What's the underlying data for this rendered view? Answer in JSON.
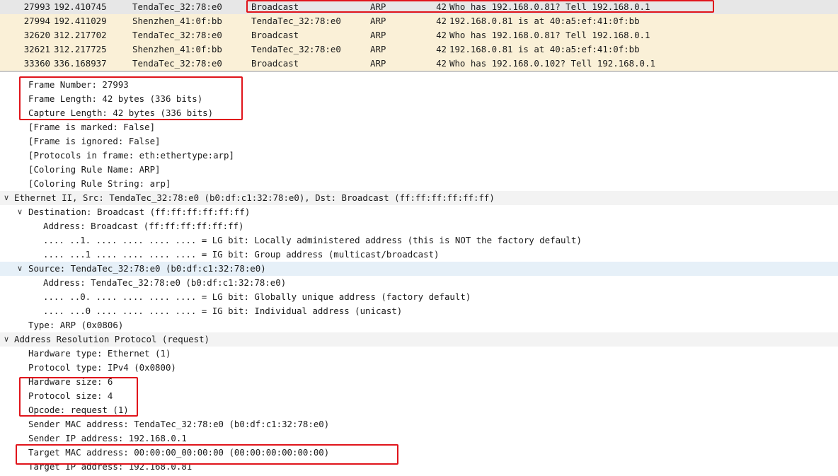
{
  "packet_list": [
    {
      "no": "27993",
      "time": "192.410745",
      "src": "TendaTec_32:78:e0",
      "dst": "Broadcast",
      "proto": "ARP",
      "len": "42",
      "info": "Who has 192.168.0.81? Tell 192.168.0.1",
      "selected": true
    },
    {
      "no": "27994",
      "time": "192.411029",
      "src": "Shenzhen_41:0f:bb",
      "dst": "TendaTec_32:78:e0",
      "proto": "ARP",
      "len": "42",
      "info": "192.168.0.81 is at 40:a5:ef:41:0f:bb",
      "selected": false
    },
    {
      "no": "32620",
      "time": "312.217702",
      "src": "TendaTec_32:78:e0",
      "dst": "Broadcast",
      "proto": "ARP",
      "len": "42",
      "info": "Who has 192.168.0.81? Tell 192.168.0.1",
      "selected": false
    },
    {
      "no": "32621",
      "time": "312.217725",
      "src": "Shenzhen_41:0f:bb",
      "dst": "TendaTec_32:78:e0",
      "proto": "ARP",
      "len": "42",
      "info": "192.168.0.81 is at 40:a5:ef:41:0f:bb",
      "selected": false
    },
    {
      "no": "33360",
      "time": "336.168937",
      "src": "TendaTec_32:78:e0",
      "dst": "Broadcast",
      "proto": "ARP",
      "len": "42",
      "info": "Who has 192.168.0.102? Tell 192.168.0.1",
      "selected": false
    }
  ],
  "details": [
    {
      "text": "Frame Number: 27993",
      "level": 2,
      "arrow": "",
      "style": ""
    },
    {
      "text": "Frame Length: 42 bytes (336 bits)",
      "level": 2,
      "arrow": "",
      "style": ""
    },
    {
      "text": "Capture Length: 42 bytes (336 bits)",
      "level": 2,
      "arrow": "",
      "style": ""
    },
    {
      "text": "[Frame is marked: False]",
      "level": 2,
      "arrow": "",
      "style": ""
    },
    {
      "text": "[Frame is ignored: False]",
      "level": 2,
      "arrow": "",
      "style": ""
    },
    {
      "text": "[Protocols in frame: eth:ethertype:arp]",
      "level": 2,
      "arrow": "",
      "style": ""
    },
    {
      "text": "[Coloring Rule Name: ARP]",
      "level": 2,
      "arrow": "",
      "style": ""
    },
    {
      "text": "[Coloring Rule String: arp]",
      "level": 2,
      "arrow": "",
      "style": ""
    },
    {
      "text": "Ethernet II, Src: TendaTec_32:78:e0 (b0:df:c1:32:78:e0), Dst: Broadcast (ff:ff:ff:ff:ff:ff)",
      "level": 1,
      "arrow": "expanded",
      "style": "hdr"
    },
    {
      "text": "Destination: Broadcast (ff:ff:ff:ff:ff:ff)",
      "level": 2,
      "arrow": "expanded",
      "style": ""
    },
    {
      "text": "Address: Broadcast (ff:ff:ff:ff:ff:ff)",
      "level": 3,
      "arrow": "",
      "style": ""
    },
    {
      "text": ".... ..1. .... .... .... .... = LG bit: Locally administered address (this is NOT the factory default)",
      "level": 3,
      "arrow": "",
      "style": ""
    },
    {
      "text": ".... ...1 .... .... .... .... = IG bit: Group address (multicast/broadcast)",
      "level": 3,
      "arrow": "",
      "style": ""
    },
    {
      "text": "Source: TendaTec_32:78:e0 (b0:df:c1:32:78:e0)",
      "level": 2,
      "arrow": "expanded",
      "style": "hl"
    },
    {
      "text": "Address: TendaTec_32:78:e0 (b0:df:c1:32:78:e0)",
      "level": 3,
      "arrow": "",
      "style": ""
    },
    {
      "text": ".... ..0. .... .... .... .... = LG bit: Globally unique address (factory default)",
      "level": 3,
      "arrow": "",
      "style": ""
    },
    {
      "text": ".... ...0 .... .... .... .... = IG bit: Individual address (unicast)",
      "level": 3,
      "arrow": "",
      "style": ""
    },
    {
      "text": "Type: ARP (0x0806)",
      "level": 2,
      "arrow": "",
      "style": ""
    },
    {
      "text": "Address Resolution Protocol (request)",
      "level": 1,
      "arrow": "expanded",
      "style": "hdr"
    },
    {
      "text": "Hardware type: Ethernet (1)",
      "level": 2,
      "arrow": "",
      "style": ""
    },
    {
      "text": "Protocol type: IPv4 (0x0800)",
      "level": 2,
      "arrow": "",
      "style": ""
    },
    {
      "text": "Hardware size: 6",
      "level": 2,
      "arrow": "",
      "style": ""
    },
    {
      "text": "Protocol size: 4",
      "level": 2,
      "arrow": "",
      "style": ""
    },
    {
      "text": "Opcode: request (1)",
      "level": 2,
      "arrow": "",
      "style": ""
    },
    {
      "text": "Sender MAC address: TendaTec_32:78:e0 (b0:df:c1:32:78:e0)",
      "level": 2,
      "arrow": "",
      "style": ""
    },
    {
      "text": "Sender IP address: 192.168.0.1",
      "level": 2,
      "arrow": "",
      "style": ""
    },
    {
      "text": "Target MAC address: 00:00:00_00:00:00 (00:00:00:00:00:00)",
      "level": 2,
      "arrow": "",
      "style": ""
    },
    {
      "text": "Target IP address: 192.168.0.81",
      "level": 2,
      "arrow": "",
      "style": ""
    }
  ],
  "annotation_color": "#e0141b",
  "icons": {
    "expanded": "chevron-down-icon"
  }
}
